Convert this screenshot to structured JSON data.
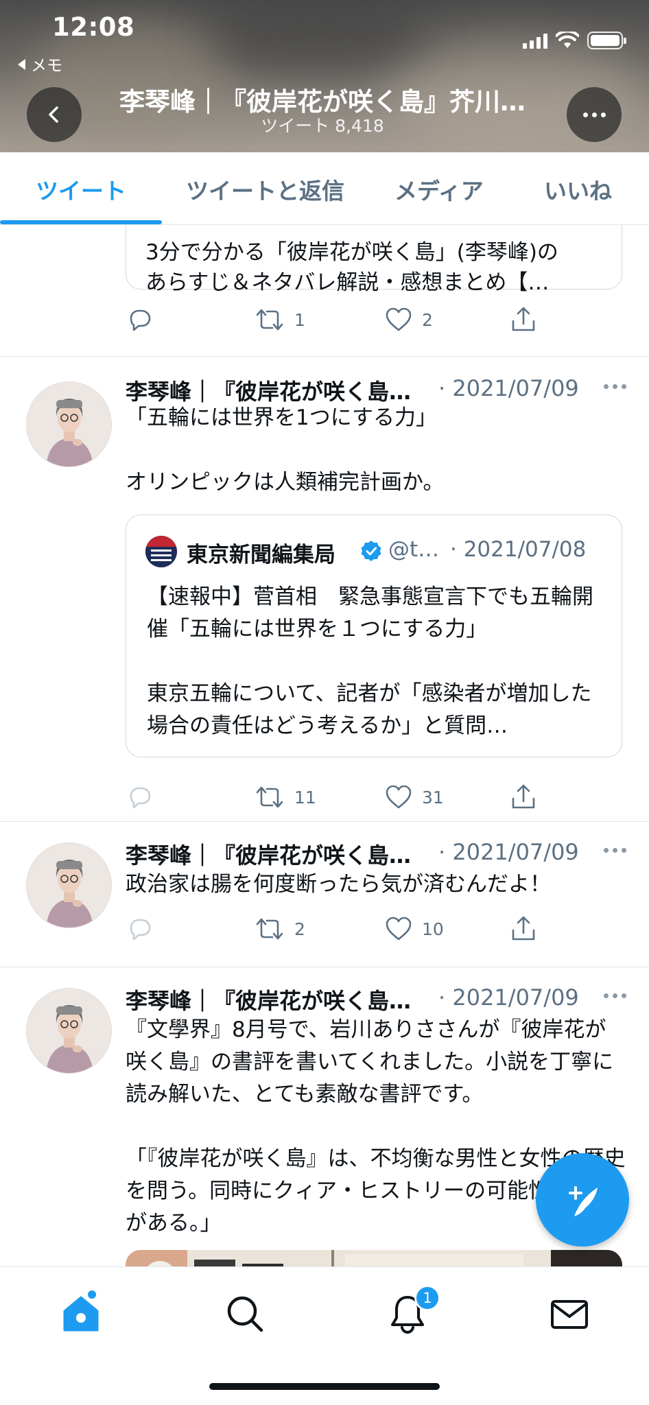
{
  "status_bar": {
    "time": "12:08",
    "back_app": "メモ"
  },
  "profile_header": {
    "title": "李琴峰｜『彼岸花が咲く島』芥川…",
    "tweet_count": "ツイート 8,418"
  },
  "tabs": [
    {
      "label": "ツイート",
      "active": true
    },
    {
      "label": "ツイートと返信",
      "active": false
    },
    {
      "label": "メディア",
      "active": false
    },
    {
      "label": "いいね",
      "active": false
    }
  ],
  "partial_tweet": {
    "quote_lines": [
      "3分で分かる「彼岸花が咲く島」(李琴峰)の",
      "あらすじ＆ネタバレ解説・感想まとめ【…"
    ],
    "retweets": "1",
    "likes": "2"
  },
  "tweets": [
    {
      "author": "李琴峰｜『彼岸花が咲く島…",
      "date": "· 2021/07/09",
      "body": "「五輪には世界を1つにする力」\n\nオリンピックは人類補完計画か。",
      "quote": {
        "name": "東京新聞編集局",
        "handle": "@t…",
        "date": "· 2021/07/08",
        "text": "【速報中】菅首相　緊急事態宣言下でも五輪開催「五輪には世界を１つにする力」\n\n東京五輪について、記者が「感染者が増加した場合の責任はどう考えるか」と質問…",
        "logo_text": "東京新聞編集局"
      },
      "retweets": "11",
      "likes": "31"
    },
    {
      "author": "李琴峰｜『彼岸花が咲く島…",
      "date": "· 2021/07/09",
      "body": "政治家は腸を何度断ったら気が済むんだよ！",
      "retweets": "2",
      "likes": "10"
    },
    {
      "author": "李琴峰｜『彼岸花が咲く島…",
      "date": "· 2021/07/09",
      "body": "『文學界』8月号で、岩川ありささんが『彼岸花が咲く島』の書評を書いてくれました。小説を丁寧に読み解いた、とても素敵な書評です。\n\n「『彼岸花が咲く島』は、不均衡な男性と女性の歴史を問う。同時にクィア・ヒストリーの可能性の萌芽がある。」"
    }
  ],
  "bottom_nav": {
    "notification_badge": "1"
  },
  "colors": {
    "accent": "#1d9bf0",
    "secondary_text": "#5b7083",
    "border": "#cfd9de"
  },
  "icons": [
    "back-arrow-icon",
    "more-icon",
    "reply-icon",
    "retweet-icon",
    "like-icon",
    "share-icon",
    "verified-icon",
    "compose-icon",
    "home-icon",
    "search-icon",
    "bell-icon",
    "mail-icon"
  ]
}
